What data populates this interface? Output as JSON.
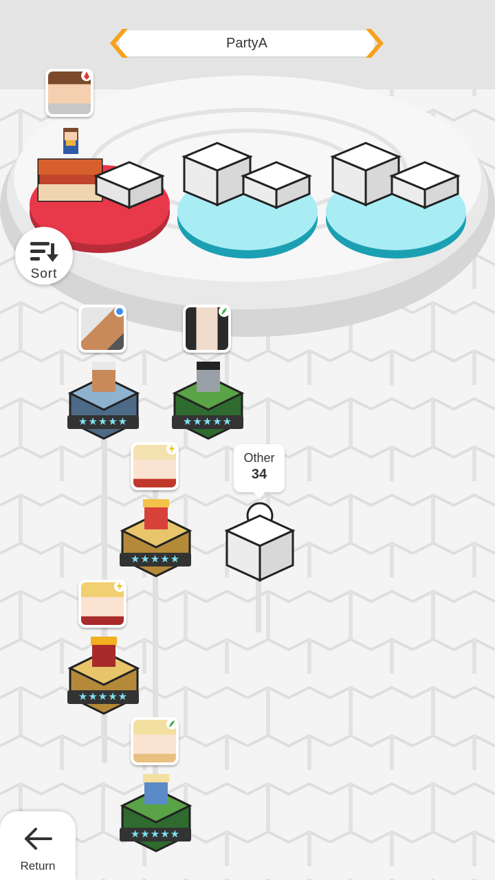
{
  "header": {
    "party_name": "PartyA"
  },
  "sort": {
    "label": "Sort"
  },
  "return": {
    "label": "Return"
  },
  "other": {
    "label": "Other",
    "count": "34"
  },
  "stars": "★★★★★",
  "colors": {
    "accent_orange": "#f6a21a",
    "slot_red": "#e8394a",
    "slot_cyan": "#a8ecf4"
  },
  "units": [
    {
      "name": "silver-haired",
      "base": "blue",
      "badge": "blue-dot",
      "rarity": 5
    },
    {
      "name": "black-haired",
      "base": "green",
      "badge": "green-leaf",
      "rarity": 5
    },
    {
      "name": "blonde-twin",
      "base": "gold",
      "badge": "lightning",
      "rarity": 5
    },
    {
      "name": "blonde-crown",
      "base": "gold",
      "badge": "lightning",
      "rarity": 5
    },
    {
      "name": "blonde-blue",
      "base": "green",
      "badge": "green-leaf",
      "rarity": 5
    }
  ]
}
